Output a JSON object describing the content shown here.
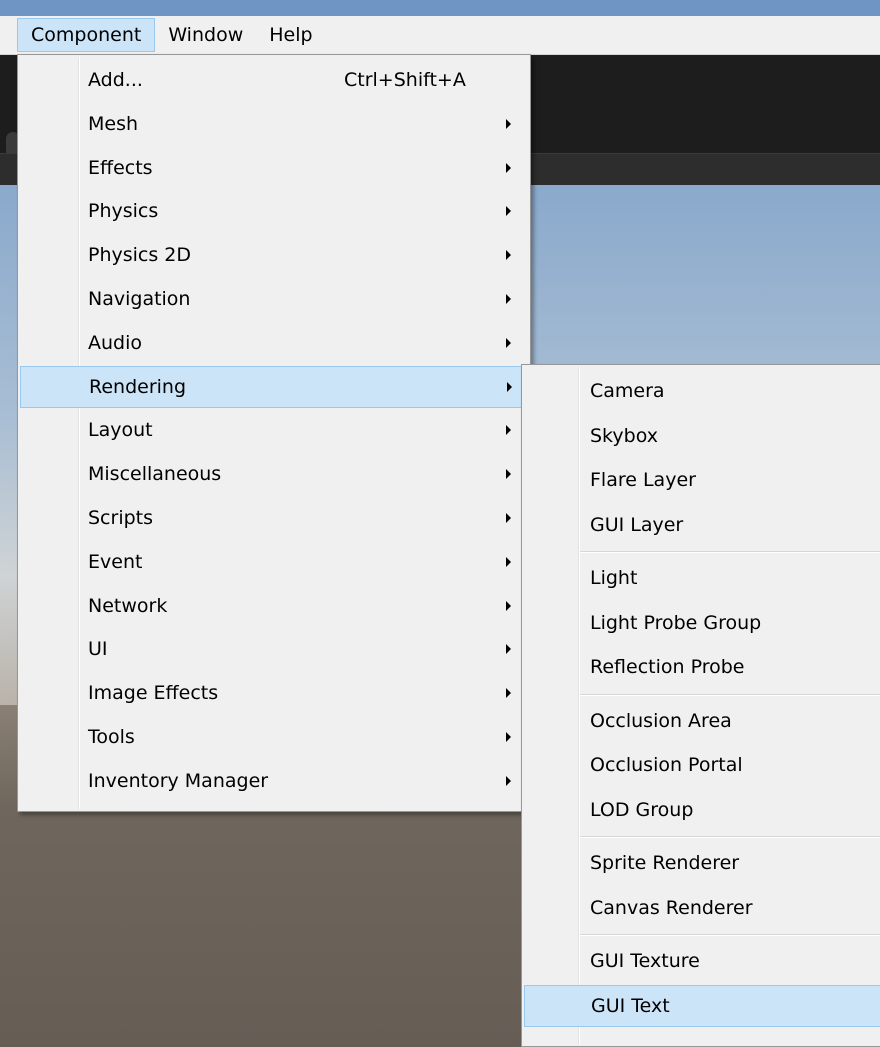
{
  "menubar": {
    "items": [
      {
        "label": "Component",
        "active": true
      },
      {
        "label": "Window",
        "active": false
      },
      {
        "label": "Help",
        "active": false
      }
    ]
  },
  "component_menu": {
    "items": [
      {
        "label": "Add...",
        "shortcut": "Ctrl+Shift+A",
        "submenu": false
      },
      {
        "label": "Mesh",
        "submenu": true
      },
      {
        "label": "Effects",
        "submenu": true
      },
      {
        "label": "Physics",
        "submenu": true
      },
      {
        "label": "Physics 2D",
        "submenu": true
      },
      {
        "label": "Navigation",
        "submenu": true
      },
      {
        "label": "Audio",
        "submenu": true
      },
      {
        "label": "Rendering",
        "submenu": true,
        "highlighted": true
      },
      {
        "label": "Layout",
        "submenu": true
      },
      {
        "label": "Miscellaneous",
        "submenu": true
      },
      {
        "label": "Scripts",
        "submenu": true
      },
      {
        "label": "Event",
        "submenu": true
      },
      {
        "label": "Network",
        "submenu": true
      },
      {
        "label": "UI",
        "submenu": true
      },
      {
        "label": "Image Effects",
        "submenu": true
      },
      {
        "label": "Tools",
        "submenu": true
      },
      {
        "label": "Inventory Manager",
        "submenu": true
      }
    ]
  },
  "rendering_submenu": {
    "groups": [
      [
        "Camera",
        "Skybox",
        "Flare Layer",
        "GUI Layer"
      ],
      [
        "Light",
        "Light Probe Group",
        "Reflection Probe"
      ],
      [
        "Occlusion Area",
        "Occlusion Portal",
        "LOD Group"
      ],
      [
        "Sprite Renderer",
        "Canvas Renderer"
      ],
      [
        "GUI Texture",
        "GUI Text"
      ]
    ],
    "highlighted": "GUI Text"
  },
  "colors": {
    "menu_bg": "#f0f0f0",
    "highlight_bg": "#cce4f7",
    "highlight_border": "#99c9ef",
    "menubar_bg": "#f0f0f0"
  },
  "icons": {
    "submenu_arrow": "triangle-right-icon"
  }
}
